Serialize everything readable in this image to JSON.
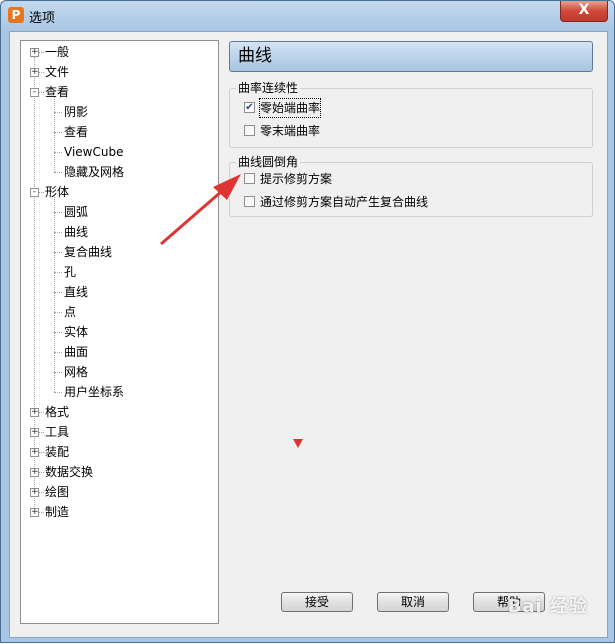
{
  "window": {
    "title": "选项",
    "app_icon_letter": "P",
    "close_symbol": "X"
  },
  "tree": {
    "nodes": [
      {
        "label": "一般",
        "expanded": false
      },
      {
        "label": "文件",
        "expanded": false
      },
      {
        "label": "查看",
        "expanded": true,
        "children": [
          "阴影",
          "查看",
          "ViewCube",
          "隐藏及网格"
        ]
      },
      {
        "label": "形体",
        "expanded": true,
        "children": [
          "圆弧",
          "曲线",
          "复合曲线",
          "孔",
          "直线",
          "点",
          "实体",
          "曲面",
          "网格",
          "用户坐标系"
        ]
      },
      {
        "label": "格式",
        "expanded": false
      },
      {
        "label": "工具",
        "expanded": false
      },
      {
        "label": "装配",
        "expanded": false
      },
      {
        "label": "数据交换",
        "expanded": false
      },
      {
        "label": "绘图",
        "expanded": false
      },
      {
        "label": "制造",
        "expanded": false
      }
    ],
    "expand_symbol": "+",
    "collapse_symbol": "-"
  },
  "panel": {
    "title": "曲线",
    "group1": {
      "title": "曲率连续性",
      "options": [
        {
          "label": "零始端曲率",
          "checked": true
        },
        {
          "label": "零末端曲率",
          "checked": false
        }
      ]
    },
    "group2": {
      "title": "曲线圆倒角",
      "options": [
        {
          "label": "提示修剪方案",
          "checked": false
        },
        {
          "label": "通过修剪方案自动产生复合曲线",
          "checked": false
        }
      ]
    }
  },
  "buttons": {
    "accept": "接受",
    "cancel": "取消",
    "help": "帮助"
  },
  "annotation": {
    "arrow_color": "#e03434"
  },
  "watermark": "Bai 经验"
}
